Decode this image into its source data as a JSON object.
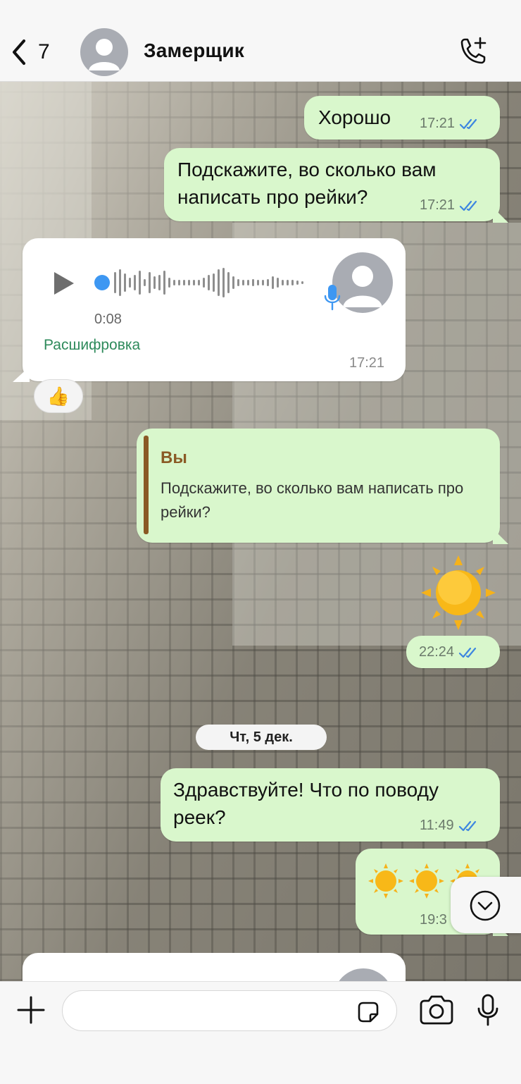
{
  "header": {
    "back_count": "7",
    "contact_name": "Замерщик"
  },
  "messages": [
    {
      "text": "Хорошо",
      "time": "17:21"
    },
    {
      "text": "Подскажите, во сколько вам написать про рейки?",
      "time": "17:21"
    },
    {
      "voice_duration": "0:08",
      "transcribe_label": "Расшифровка",
      "time": "17:21",
      "reaction": "👍"
    },
    {
      "quote_author": "Вы",
      "quote_text": "Подскажите, во сколько вам написать про рейки?"
    },
    {
      "emoji": "☀️",
      "time": "22:24"
    },
    {
      "text": "Здравствуйте! Что по поводу реек?",
      "time": "11:49"
    },
    {
      "emoji": "☀️☀️☀️",
      "time": "19:3"
    }
  ],
  "date_separator": "Чт, 5 дек.",
  "input": {
    "placeholder": ""
  },
  "colors": {
    "outgoing": "#d9f7cc",
    "incoming": "#ffffff",
    "tick": "#3d86e0",
    "link": "#2e8a5b",
    "quote": "#8a5a25"
  }
}
